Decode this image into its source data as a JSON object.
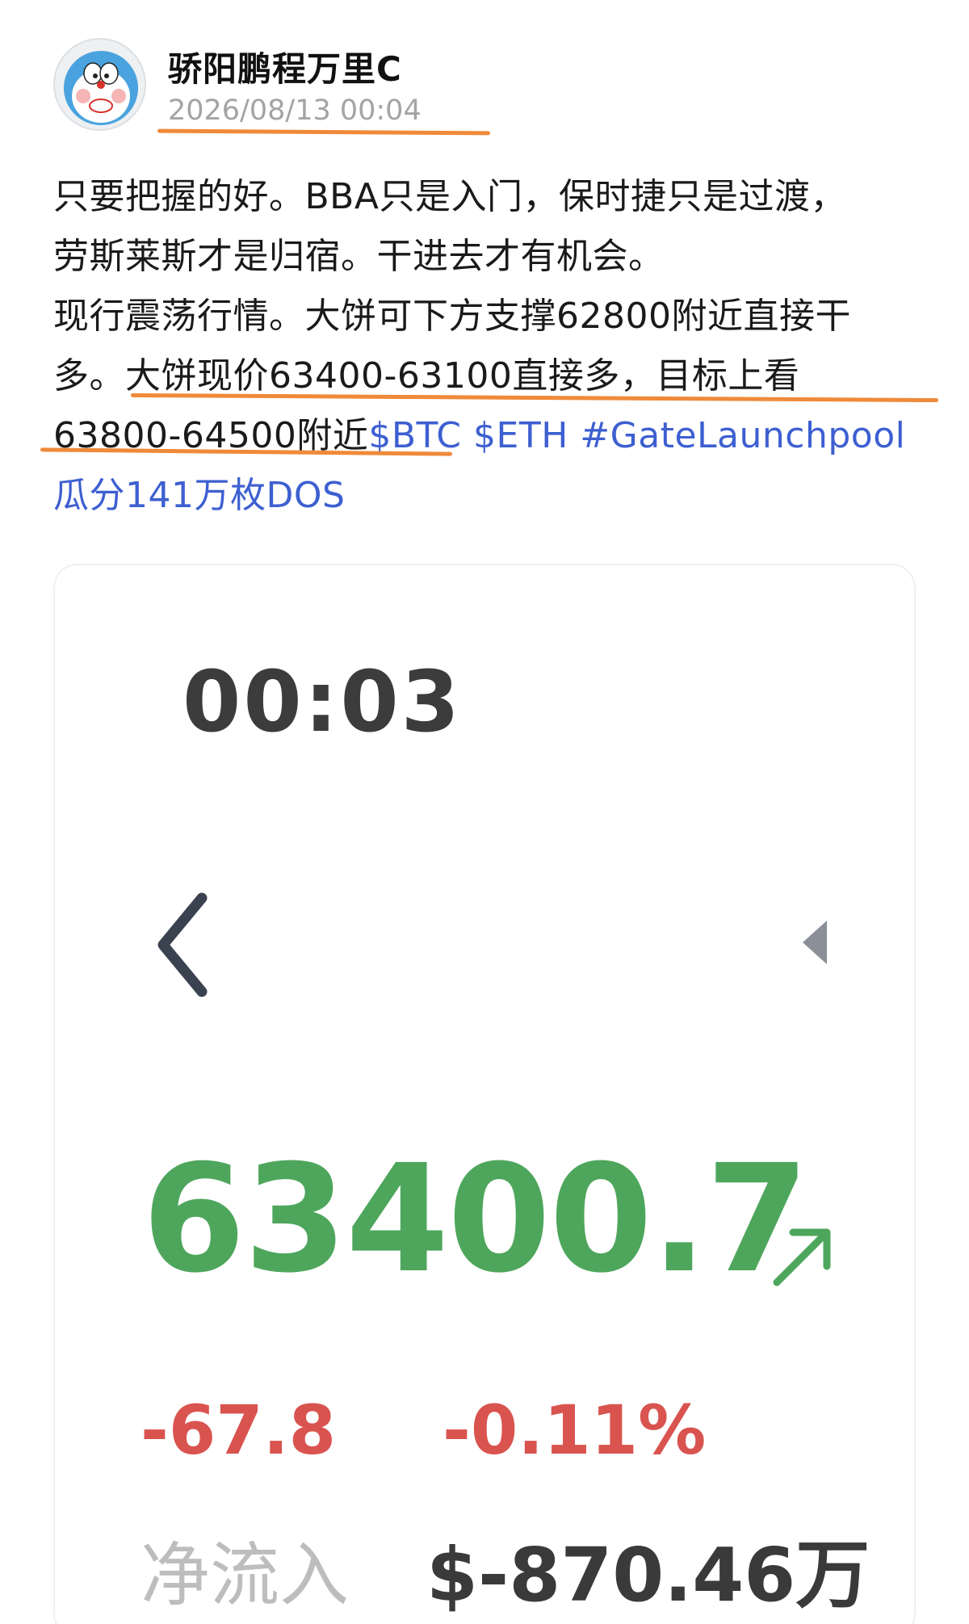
{
  "post": {
    "author": "骄阳鹏程万里C",
    "timestamp": "2026/08/13 00:04",
    "lines": {
      "l1": "只要把握的好。BBA只是入门，保时捷只是过渡，",
      "l2": "劳斯莱斯才是归宿。干进去才有机会。",
      "l3": "现行震荡行情。大饼可下方支撑62800附近直接干",
      "l4": "多。大饼现价63400-63100直接多，目标上看",
      "l5_text": "63800-64500附近",
      "l5_tag1": "$BTC",
      "l5_tag2": "$ETH",
      "l5_tag3": "#GateLaunchpool",
      "l6_tag": "瓜分141万枚DOS"
    }
  },
  "card": {
    "timer": "00:03",
    "price": "63400.7",
    "change_abs": "-67.8",
    "change_pct": "-0.11%",
    "netflow_label": "净流入",
    "netflow_value": "$-870.46万"
  },
  "colors": {
    "price_up": "#4ea65c",
    "price_down": "#d9534f",
    "hashtag": "#3d5fd1",
    "highlight_mark": "#ef8a3a"
  },
  "icons": {
    "avatar": "doraemon-avatar-icon",
    "prev": "chevron-left-icon",
    "next": "triangle-right-icon",
    "trend": "arrow-up-right-icon"
  }
}
